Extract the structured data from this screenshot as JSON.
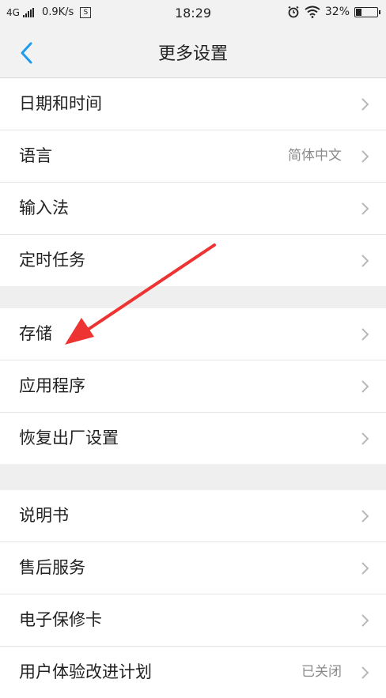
{
  "status_bar": {
    "network": "4G",
    "speed": "0.9K/s",
    "s_icon": "S",
    "time": "18:29",
    "battery": "32%",
    "battery_level": 0.32
  },
  "header": {
    "title": "更多设置"
  },
  "groups": [
    {
      "items": [
        {
          "label": "日期和时间"
        },
        {
          "label": "语言",
          "value": "简体中文"
        },
        {
          "label": "输入法"
        },
        {
          "label": "定时任务"
        }
      ]
    },
    {
      "items": [
        {
          "label": "存储"
        },
        {
          "label": "应用程序"
        },
        {
          "label": "恢复出厂设置"
        }
      ]
    },
    {
      "items": [
        {
          "label": "说明书"
        },
        {
          "label": "售后服务"
        },
        {
          "label": "电子保修卡"
        },
        {
          "label": "用户体验改进计划",
          "value": "已关闭"
        }
      ]
    }
  ],
  "colors": {
    "accent": "#1a9bf0",
    "annotation": "#ee3333",
    "chevron": "#b8b8b8"
  },
  "icons": [
    "back-icon",
    "chevron-right-icon",
    "alarm-icon",
    "wifi-icon",
    "battery-icon",
    "signal-icon"
  ]
}
